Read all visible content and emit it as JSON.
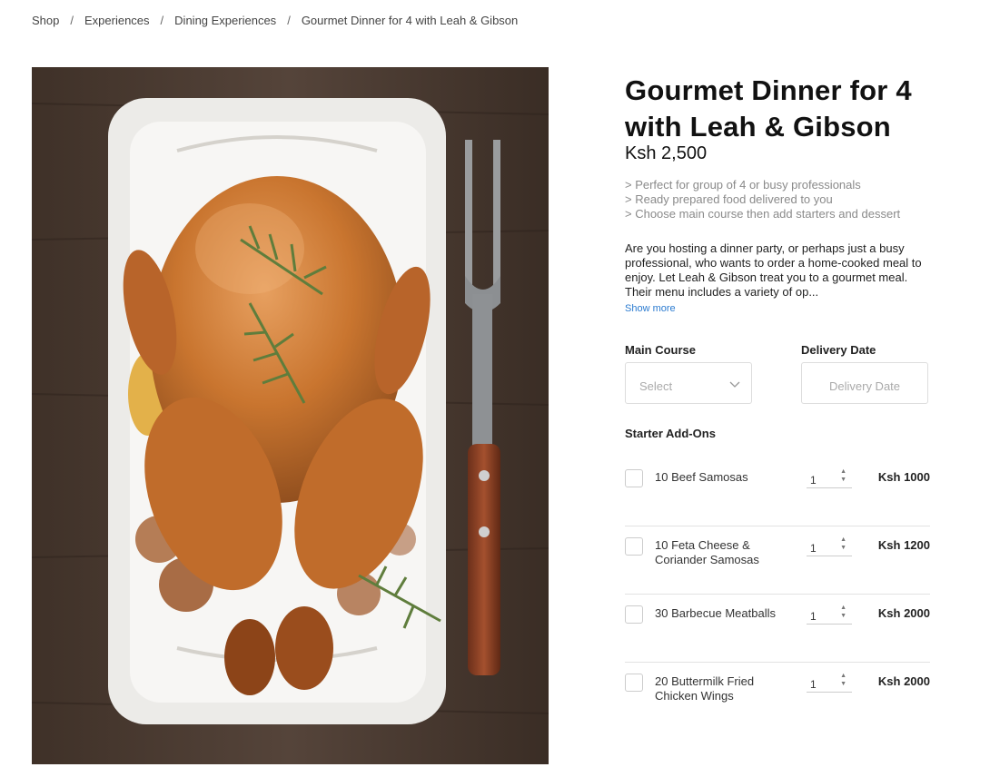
{
  "breadcrumb": {
    "items": [
      "Shop",
      "Experiences",
      "Dining Experiences"
    ],
    "separator": "/",
    "current": "Gourmet Dinner for 4 with Leah & Gibson"
  },
  "product": {
    "title": "Gourmet Dinner for 4 with Leah & Gibson",
    "price": "Ksh 2,500",
    "bullets": [
      "> Perfect for group of 4 or busy professionals",
      "> Ready prepared food delivered to you",
      "> Choose main course then add starters and dessert"
    ],
    "description": "Are you hosting a dinner party, or perhaps just a busy professional, who wants to order a home-cooked meal to enjoy. Let Leah & Gibson treat you to a gourmet meal. Their menu includes a variety of op...",
    "show_more": "Show more"
  },
  "form": {
    "main_course_label": "Main Course",
    "main_course_placeholder": "Select",
    "delivery_label": "Delivery Date",
    "delivery_placeholder": "Delivery Date",
    "addons_title": "Starter Add-Ons"
  },
  "addons": [
    {
      "name": "10 Beef Samosas",
      "qty": "1",
      "price": "Ksh 1000"
    },
    {
      "name": "10 Feta Cheese & Coriander Samosas",
      "qty": "1",
      "price": "Ksh 1200"
    },
    {
      "name": "30 Barbecue Meatballs",
      "qty": "1",
      "price": "Ksh 2000"
    },
    {
      "name": "20 Buttermilk Fried Chicken Wings",
      "qty": "1",
      "price": "Ksh 2000"
    }
  ],
  "icons": {
    "chevron": "chevron-down-icon",
    "spinner_up": "▲",
    "spinner_down": "▼"
  },
  "colors": {
    "link": "#2b7bd0",
    "muted": "#8a8a8a"
  }
}
